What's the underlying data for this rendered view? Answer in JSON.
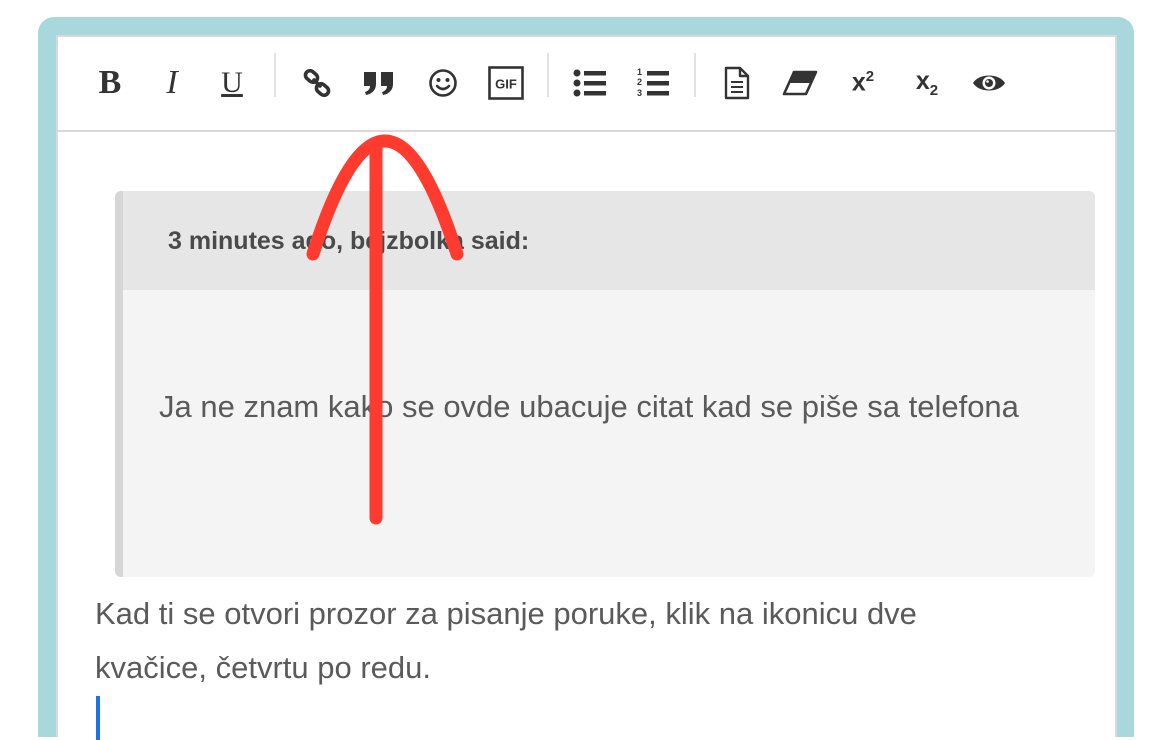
{
  "toolbar": {
    "bold_label": "B",
    "italic_label": "I",
    "underline_label": "U",
    "link_icon": "link-icon",
    "quote_icon": "quote-icon",
    "emoji_icon": "smiley-icon",
    "gif_label": "GIF",
    "bullet_list_icon": "bullet-list-icon",
    "numbered_list_icon": "numbered-list-icon",
    "numbered_list_digits": [
      "1",
      "2",
      "3"
    ],
    "document_icon": "document-icon",
    "eraser_icon": "eraser-icon",
    "superscript_base": "x",
    "superscript_exp": "2",
    "subscript_base": "x",
    "subscript_idx": "2",
    "preview_icon": "eye-icon"
  },
  "quote": {
    "citation": "3 minutes ago, bejzbolka said:",
    "body": "Ja ne znam kako se ovde ubacuje citat kad se piše sa telefona"
  },
  "reply": {
    "text": "Kad ti se otvori prozor za pisanje poruke, klik na ikonicu dve kvačice, četvrtu po redu."
  },
  "colors": {
    "frame": "#a9d8dc",
    "annotation_arrow": "#ff3b30",
    "caret": "#1a73e8"
  }
}
